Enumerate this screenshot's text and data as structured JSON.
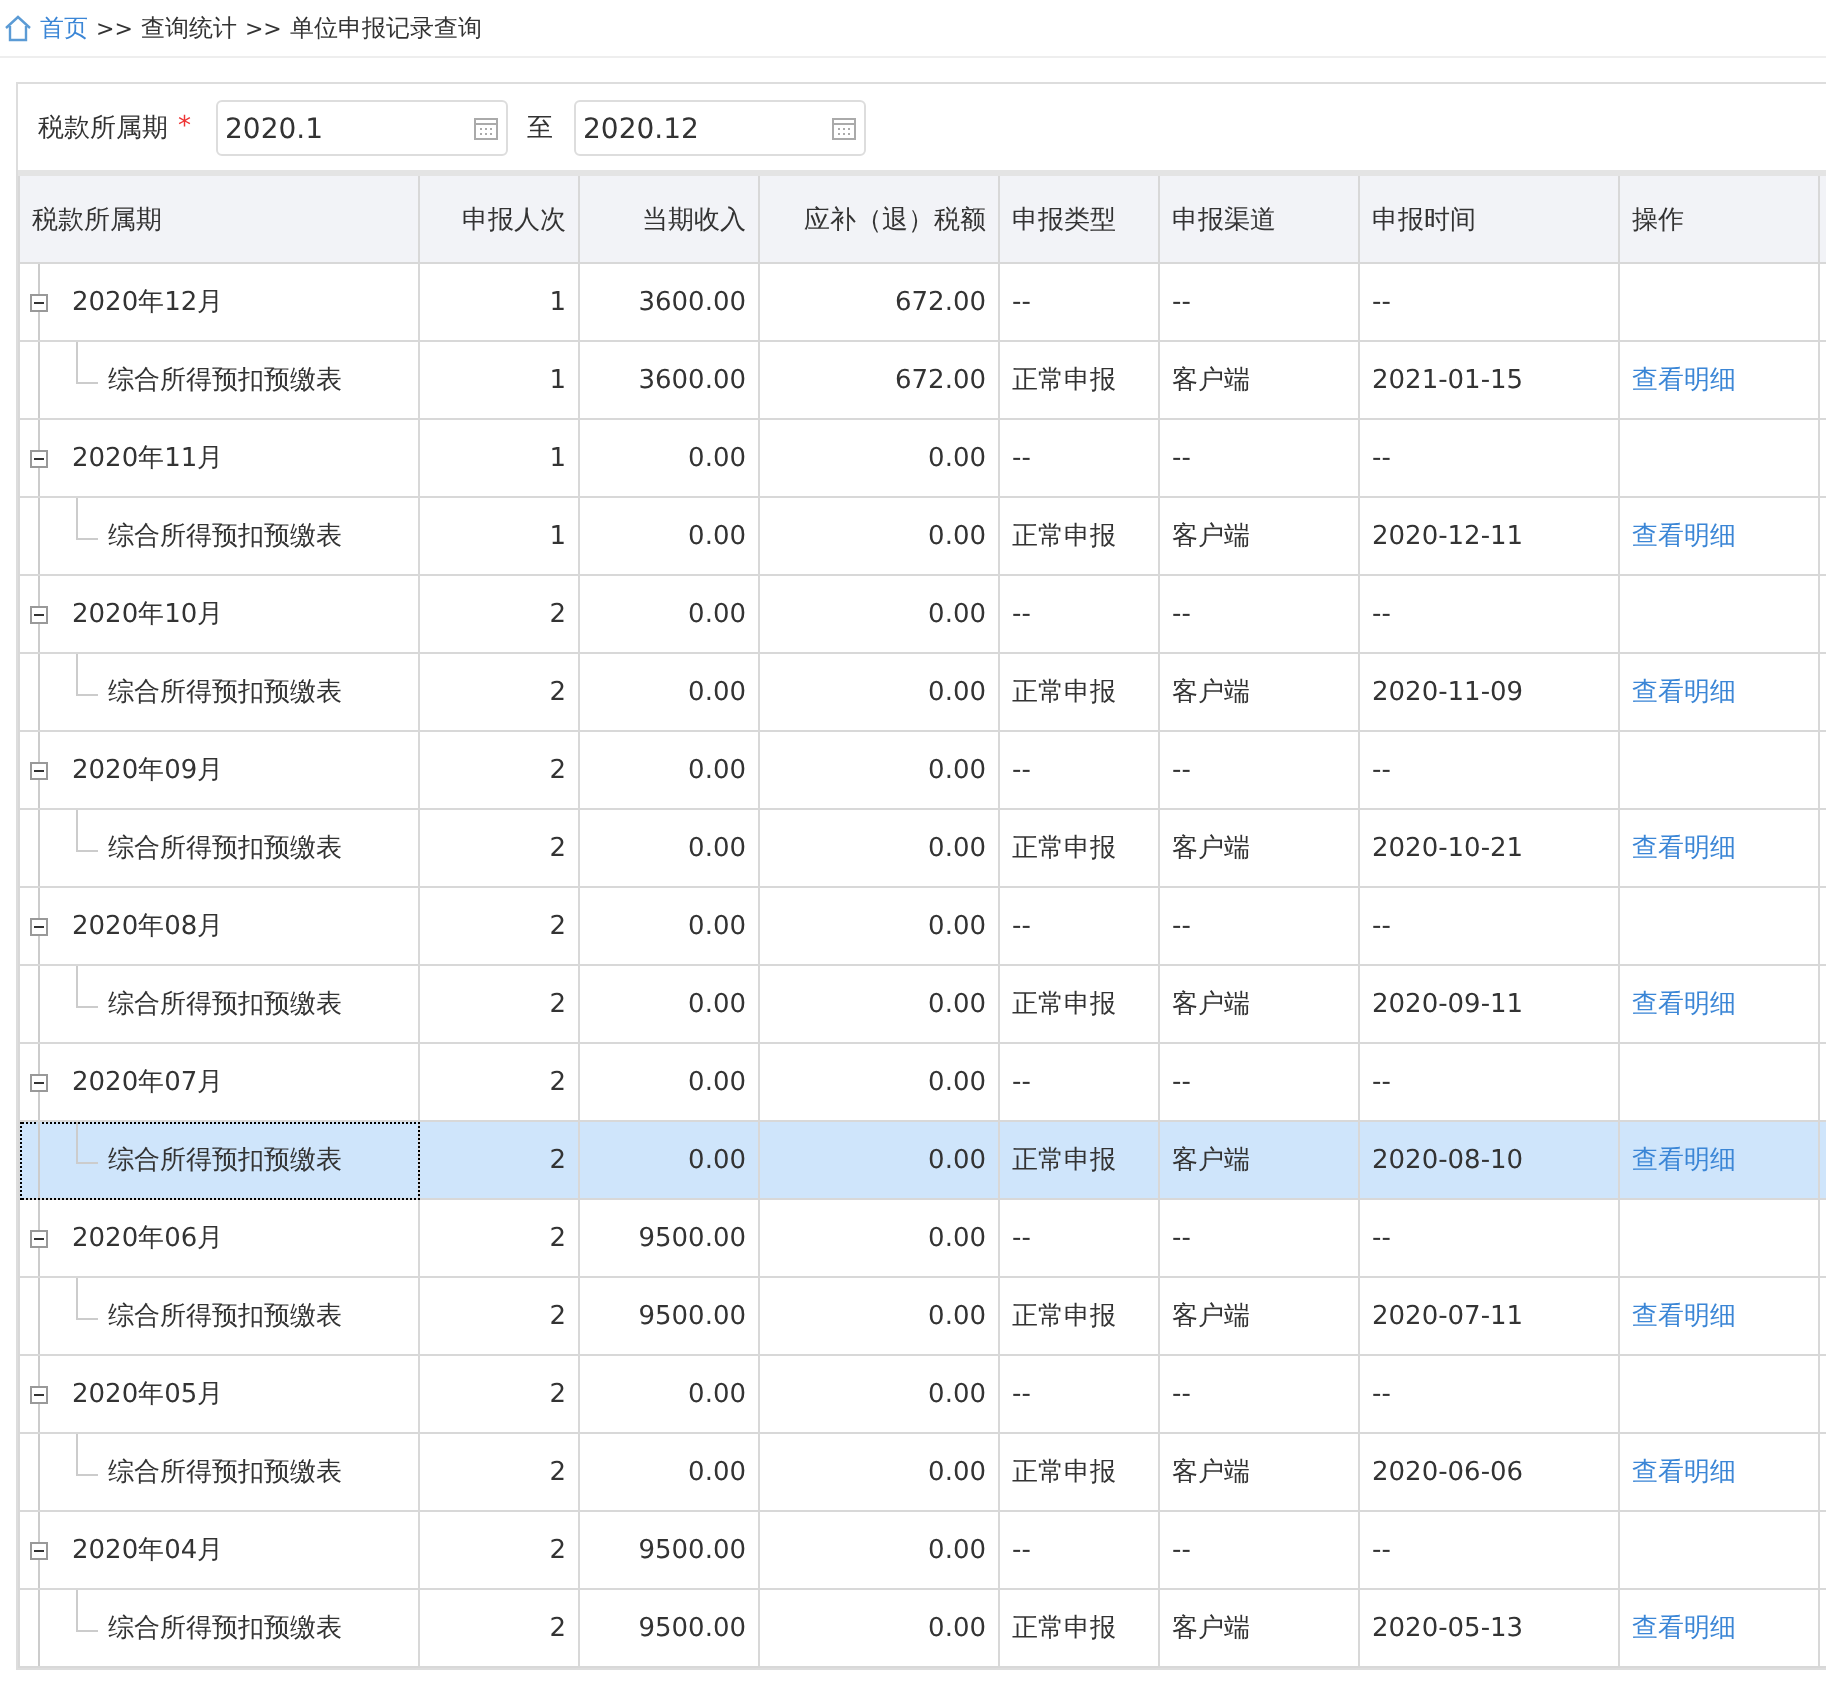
{
  "breadcrumb": {
    "home": "首页",
    "separator_1": ">>",
    "section": "查询统计",
    "separator_2": ">>",
    "current": "单位申报记录查询"
  },
  "filter": {
    "label": "税款所属期",
    "required_mark": "*",
    "from": "2020.1",
    "to_label": "至",
    "to": "2020.12"
  },
  "table": {
    "columns": [
      "税款所属期",
      "申报人次",
      "当期收入",
      "应补（退）税额",
      "申报类型",
      "申报渠道",
      "申报时间",
      "操作"
    ],
    "groups": [
      {
        "period": "2020年12月",
        "count": "1",
        "income": "3600.00",
        "tax": "672.00",
        "type": "--",
        "channel": "--",
        "time": "--",
        "expanded": true,
        "children": [
          {
            "name": "综合所得预扣预缴表",
            "count": "1",
            "income": "3600.00",
            "tax": "672.00",
            "type": "正常申报",
            "channel": "客户端",
            "time": "2021-01-15",
            "action": "查看明细",
            "selected": false
          }
        ]
      },
      {
        "period": "2020年11月",
        "count": "1",
        "income": "0.00",
        "tax": "0.00",
        "type": "--",
        "channel": "--",
        "time": "--",
        "expanded": true,
        "children": [
          {
            "name": "综合所得预扣预缴表",
            "count": "1",
            "income": "0.00",
            "tax": "0.00",
            "type": "正常申报",
            "channel": "客户端",
            "time": "2020-12-11",
            "action": "查看明细",
            "selected": false
          }
        ]
      },
      {
        "period": "2020年10月",
        "count": "2",
        "income": "0.00",
        "tax": "0.00",
        "type": "--",
        "channel": "--",
        "time": "--",
        "expanded": true,
        "children": [
          {
            "name": "综合所得预扣预缴表",
            "count": "2",
            "income": "0.00",
            "tax": "0.00",
            "type": "正常申报",
            "channel": "客户端",
            "time": "2020-11-09",
            "action": "查看明细",
            "selected": false
          }
        ]
      },
      {
        "period": "2020年09月",
        "count": "2",
        "income": "0.00",
        "tax": "0.00",
        "type": "--",
        "channel": "--",
        "time": "--",
        "expanded": true,
        "children": [
          {
            "name": "综合所得预扣预缴表",
            "count": "2",
            "income": "0.00",
            "tax": "0.00",
            "type": "正常申报",
            "channel": "客户端",
            "time": "2020-10-21",
            "action": "查看明细",
            "selected": false
          }
        ]
      },
      {
        "period": "2020年08月",
        "count": "2",
        "income": "0.00",
        "tax": "0.00",
        "type": "--",
        "channel": "--",
        "time": "--",
        "expanded": true,
        "children": [
          {
            "name": "综合所得预扣预缴表",
            "count": "2",
            "income": "0.00",
            "tax": "0.00",
            "type": "正常申报",
            "channel": "客户端",
            "time": "2020-09-11",
            "action": "查看明细",
            "selected": false
          }
        ]
      },
      {
        "period": "2020年07月",
        "count": "2",
        "income": "0.00",
        "tax": "0.00",
        "type": "--",
        "channel": "--",
        "time": "--",
        "expanded": true,
        "children": [
          {
            "name": "综合所得预扣预缴表",
            "count": "2",
            "income": "0.00",
            "tax": "0.00",
            "type": "正常申报",
            "channel": "客户端",
            "time": "2020-08-10",
            "action": "查看明细",
            "selected": true
          }
        ]
      },
      {
        "period": "2020年06月",
        "count": "2",
        "income": "9500.00",
        "tax": "0.00",
        "type": "--",
        "channel": "--",
        "time": "--",
        "expanded": true,
        "children": [
          {
            "name": "综合所得预扣预缴表",
            "count": "2",
            "income": "9500.00",
            "tax": "0.00",
            "type": "正常申报",
            "channel": "客户端",
            "time": "2020-07-11",
            "action": "查看明细",
            "selected": false
          }
        ]
      },
      {
        "period": "2020年05月",
        "count": "2",
        "income": "0.00",
        "tax": "0.00",
        "type": "--",
        "channel": "--",
        "time": "--",
        "expanded": true,
        "children": [
          {
            "name": "综合所得预扣预缴表",
            "count": "2",
            "income": "0.00",
            "tax": "0.00",
            "type": "正常申报",
            "channel": "客户端",
            "time": "2020-06-06",
            "action": "查看明细",
            "selected": false
          }
        ]
      },
      {
        "period": "2020年04月",
        "count": "2",
        "income": "9500.00",
        "tax": "0.00",
        "type": "--",
        "channel": "--",
        "time": "--",
        "expanded": true,
        "children": [
          {
            "name": "综合所得预扣预缴表",
            "count": "2",
            "income": "9500.00",
            "tax": "0.00",
            "type": "正常申报",
            "channel": "客户端",
            "time": "2020-05-13",
            "action": "查看明细",
            "selected": false
          }
        ]
      }
    ]
  }
}
